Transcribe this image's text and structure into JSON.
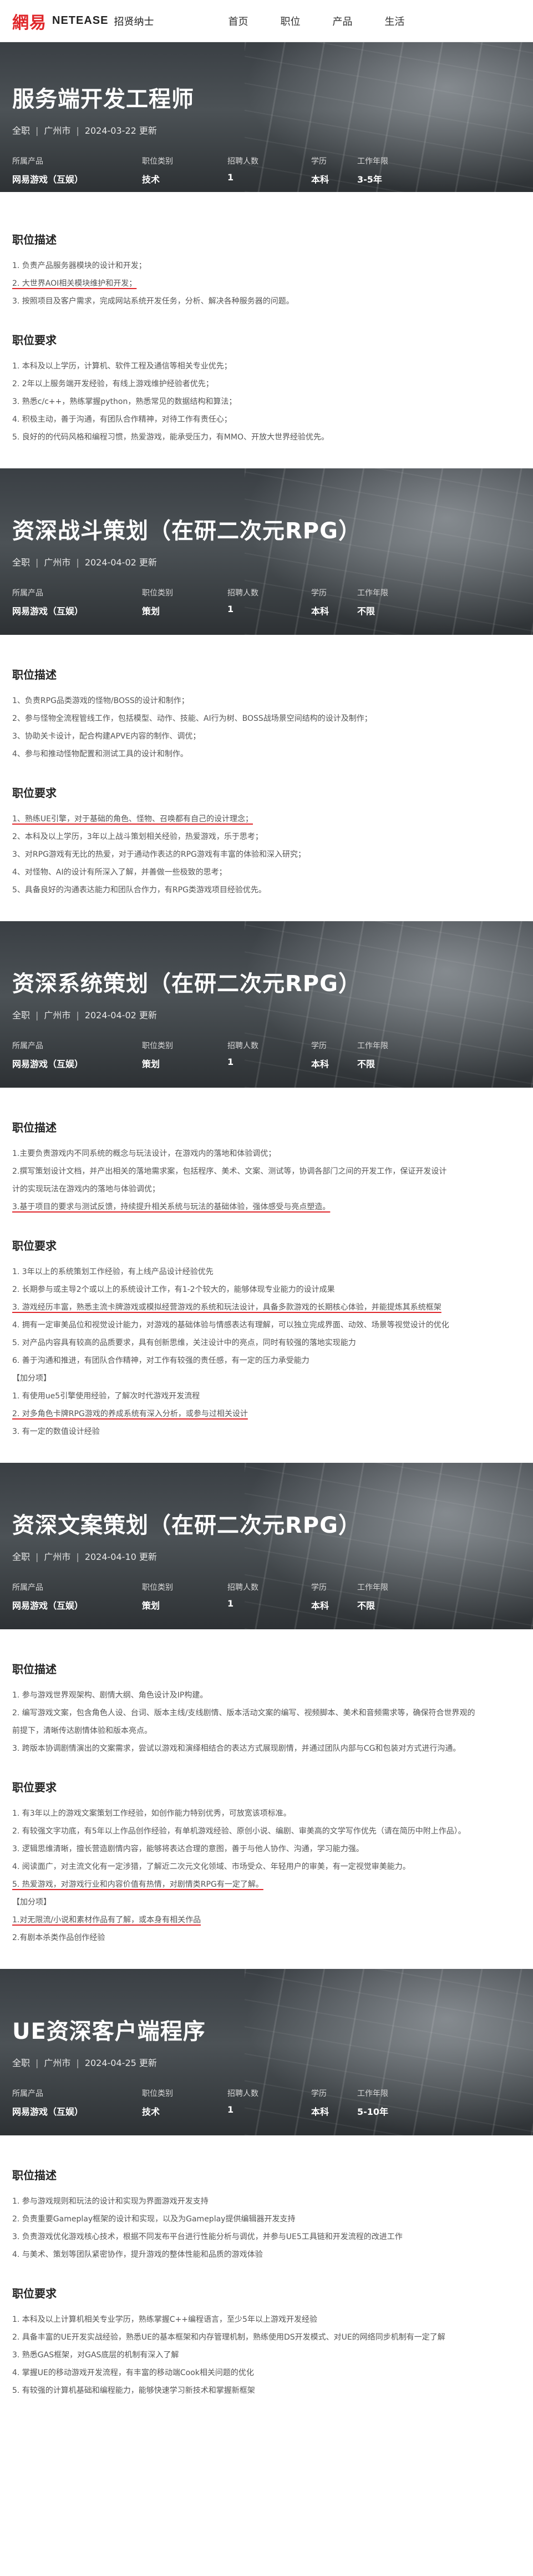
{
  "nav": {
    "logo_mark": "網易",
    "logo_text": "NETEASE",
    "logo_sub": "招贤纳士",
    "links": [
      "首页",
      "职位",
      "产品",
      "生活"
    ]
  },
  "headers": [
    "所属产品",
    "职位类别",
    "招聘人数",
    "学历",
    "工作年限"
  ],
  "jobs": [
    {
      "title": "服务端开发工程师",
      "type": "全职",
      "city": "广州市",
      "date": "2024-03-22 更新",
      "values": [
        "网易游戏（互娱）",
        "技术",
        "1",
        "本科",
        "3-5年"
      ],
      "desc_title": "职位描述",
      "desc": [
        "1. 负责产品服务器模块的设计和开发；",
        "2. 大世界AOI相关模块维护和开发；",
        "3. 按照项目及客户需求，完成网站系统开发任务，分析、解决各种服务器的问题。"
      ],
      "req_title": "职位要求",
      "req": [
        "1. 本科及以上学历，计算机、软件工程及通信等相关专业优先；",
        "2. 2年以上服务端开发经验，有线上游戏维护经验者优先；",
        "3. 熟悉c/c++，熟练掌握python，熟悉常见的数据结构和算法；",
        "4. 积极主动，善于沟通，有团队合作精神，对待工作有责任心；",
        "5. 良好的的代码风格和编程习惯，热爱游戏，能承受压力，有MMO、开放大世界经验优先。"
      ]
    },
    {
      "title": "资深战斗策划（在研二次元RPG）",
      "type": "全职",
      "city": "广州市",
      "date": "2024-04-02 更新",
      "values": [
        "网易游戏（互娱）",
        "策划",
        "1",
        "本科",
        "不限"
      ],
      "desc_title": "职位描述",
      "desc": [
        "1、负责RPG品类游戏的怪物/BOSS的设计和制作；",
        "2、参与怪物全流程管线工作，包括模型、动作、技能、AI行为树、BOSS战场景空间结构的设计及制作；",
        "3、协助关卡设计，配合构建APVE内容的制作、调优；",
        "4、参与和推动怪物配置和测试工具的设计和制作。"
      ],
      "req_title": "职位要求",
      "req": [
        "1、熟练UE引擎，对于基础的角色、怪物、召唤都有自己的设计理念；",
        "2、本科及以上学历，3年以上战斗策划相关经验，热爱游戏，乐于思考；",
        "3、对RPG游戏有无比的热爱，对于通动作表达的RPG游戏有丰富的体验和深入研究；",
        "4、对怪物、AI的设计有所深入了解，并善做一些极致的思考；",
        "5、具备良好的沟通表达能力和团队合作力，有RPG类游戏项目经验优先。"
      ]
    },
    {
      "title": "资深系统策划（在研二次元RPG）",
      "type": "全职",
      "city": "广州市",
      "date": "2024-04-02 更新",
      "values": [
        "网易游戏（互娱）",
        "策划",
        "1",
        "本科",
        "不限"
      ],
      "desc_title": "职位描述",
      "desc": [
        "1.主要负责游戏内不同系统的概念与玩法设计，在游戏内的落地和体验调优；",
        "2.撰写策划设计文档，并产出相关的落地需求案，包括程序、美术、文案、测试等，协调各部门之间的开发工作，保证开发设计",
        "计的实现玩法在游戏内的落地与体验调优；",
        "3.基于项目的要求与测试反馈，持续提升相关系统与玩法的基础体验，强体感受与亮点塑造。"
      ],
      "req_title": "职位要求",
      "req": [
        "1. 3年以上的系统策划工作经验，有上线产品设计经验优先",
        "2. 长期参与或主导2个或以上的系统设计工作，有1-2个较大的，能够体现专业能力的设计成果",
        "3. 游戏经历丰富，熟悉主流卡牌游戏或模拟经营游戏的系统和玩法设计，具备多款游戏的长期核心体验，并能提炼其系统框架",
        "4. 拥有一定审美品位和视觉设计能力，对游戏的基础体验与情感表达有理解，可以独立完成界面、动效、场景等视觉设计的优化",
        "5. 对产品内容具有较高的品质要求，具有创新思维，关注设计中的亮点，同时有较强的落地实现能力",
        "6. 善于沟通和推进，有团队合作精神，对工作有较强的责任感，有一定的压力承受能力",
        "【加分项】",
        "1. 有使用ue5引擎使用经验，了解次时代游戏开发流程",
        "2. 对多角色卡牌RPG游戏的养成系统有深入分析，或参与过相关设计",
        "3. 有一定的数值设计经验"
      ]
    },
    {
      "title": "资深文案策划（在研二次元RPG）",
      "type": "全职",
      "city": "广州市",
      "date": "2024-04-10 更新",
      "values": [
        "网易游戏（互娱）",
        "策划",
        "1",
        "本科",
        "不限"
      ],
      "desc_title": "职位描述",
      "desc": [
        "1. 参与游戏世界观架构、剧情大纲、角色设计及IP构建。",
        "2. 编写游戏文案，包含角色人设、台词、版本主线/支线剧情、版本活动文案的编写、视频脚本、美术和音频需求等，确保符合世界观的",
        "前提下，清晰传达剧情体验和版本亮点。",
        "3. 跨版本协调剧情演出的文案需求，尝试以游戏和演绎相结合的表达方式展现剧情，并通过团队内部与CG和包装对方式进行沟通。"
      ],
      "req_title": "职位要求",
      "req": [
        "1. 有3年以上的游戏文案策划工作经验，如创作能力特别优秀，可放宽该项标准。",
        "2. 有较强文字功底，有5年以上作品创作经验，有单机游戏经验、原创小说、编剧、审美高的文学写作优先（请在简历中附上作品）。",
        "3. 逻辑思维清晰，擅长营造剧情内容，能够将表达合理的意图，善于与他人协作、沟通，学习能力强。",
        "4. 阅读面广，对主流文化有一定涉猎，了解近二次元文化领域、市场受众、年轻用户的审美，有一定视觉审美能力。",
        "5. 热爱游戏，对游戏行业和内容价值有热情，对剧情类RPG有一定了解。",
        "【加分项】",
        "1.对无限流/小说和素材作品有了解，或本身有相关作品",
        "2.有剧本杀类作品创作经验"
      ]
    },
    {
      "title": "UE资深客户端程序",
      "type": "全职",
      "city": "广州市",
      "date": "2024-04-25 更新",
      "values": [
        "网易游戏（互娱）",
        "技术",
        "1",
        "本科",
        "5-10年"
      ],
      "desc_title": "职位描述",
      "desc": [
        "1. 参与游戏规则和玩法的设计和实现为界面游戏开发支持",
        "2. 负责重要Gameplay框架的设计和实现，以及为Gameplay提供编辑器开发支持",
        "3. 负责游戏优化游戏核心技术，根据不同发布平台进行性能分析与调优，并参与UE5工具链和开发流程的改进工作",
        "4. 与美术、策划等团队紧密协作，提升游戏的整体性能和品质的游戏体验"
      ],
      "req_title": "职位要求",
      "req": [
        "1. 本科及以上计算机相关专业学历，熟练掌握C++编程语言，至少5年以上游戏开发经验",
        "2. 具备丰富的UE开发实战经验，熟悉UE的基本框架和内存管理机制，熟练使用DS开发模式、对UE的网络同步机制有一定了解",
        "3. 熟悉GAS框架，对GAS底层的机制有深入了解",
        "4. 掌握UE的移动游戏开发流程，有丰富的移动端Cook相关问题的优化",
        "5. 有较强的计算机基础和编程能力，能够快速学习新技术和掌握新框架"
      ]
    }
  ]
}
